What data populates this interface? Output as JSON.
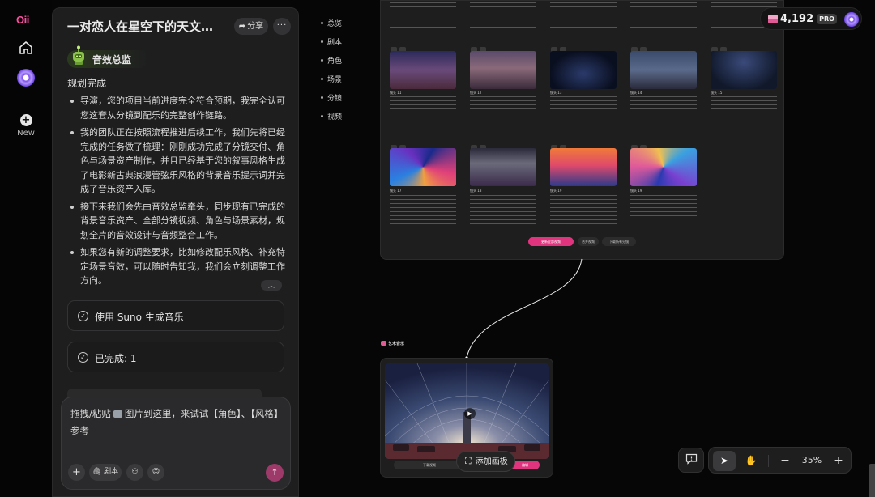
{
  "app": {
    "logo": "Oii"
  },
  "rail": {
    "new_label": "New"
  },
  "panel": {
    "title": "一对恋人在星空下的天文馆...",
    "share_label": "分享",
    "more_label": "···",
    "agent_name": "音效总监",
    "plan_title": "规划完成",
    "bullets": [
      "导演，您的项目当前进度完全符合预期，我完全认可您这套从分镜到配乐的完整创作链路。",
      "我的团队正在按照流程推进后续工作，我们先将已经完成的任务做了梳理：刚刚成功完成了分镜交付、角色与场景资产制作，并且已经基于您的叙事风格生成了电影新古典浪漫管弦乐风格的背景音乐提示词并完成了音乐资产入库。",
      "接下来我们会先由音效总监牵头，同步现有已完成的背景音乐资产、全部分镜视频、角色与场景素材，规划全片的音效设计与音频整合工作。",
      "如果您有新的调整要求，比如修改配乐风格、补充特定场景音效，可以随时告知我，我们会立刻调整工作方向。"
    ],
    "cards": [
      "使用 Suno 生成音乐",
      "已完成: 1"
    ],
    "input": {
      "text_before": "拖拽/粘贴",
      "text_after": "图片到这里，来试试【角色】、【风格】参考",
      "script_label": "剧本"
    }
  },
  "section_nav": [
    "总览",
    "剧本",
    "角色",
    "场景",
    "分镜",
    "视频"
  ],
  "credits": {
    "amount": "4,192",
    "tier": "PRO"
  },
  "board": {
    "shots_row1": [
      "镜头 11",
      "镜头 12",
      "镜头 13",
      "镜头 14",
      "镜头 15"
    ],
    "shots_row2": [
      "镜头 17",
      "镜头 18",
      "镜头 19",
      "镜头 19"
    ],
    "primary_btn": "更新全部视频",
    "secondary_btn": "合并视频",
    "download_btn": "下载所有分镜",
    "control_label": "编辑"
  },
  "music_node": {
    "label": "艺术音乐",
    "left_btn": "下载视频",
    "right_btn": "编辑"
  },
  "canvas": {
    "add_label": "添加画板"
  },
  "toolbar": {
    "zoom": "35%"
  },
  "colors": {
    "accent": "#e0347e",
    "panel": "#1e1e1f",
    "background": "#060606",
    "logo": "#ff4fa3"
  }
}
